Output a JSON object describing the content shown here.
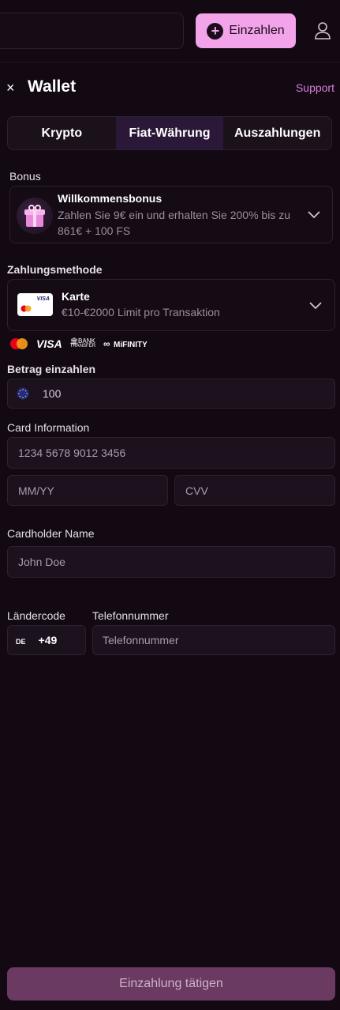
{
  "header": {
    "search_placeholder": "",
    "deposit_label": "Einzahlen",
    "plus_symbol": "+"
  },
  "wallet": {
    "close_symbol": "×",
    "title": "Wallet",
    "support_label": "Support"
  },
  "tabs": [
    {
      "label": "Krypto",
      "active": false
    },
    {
      "label": "Fiat-Währung",
      "active": true
    },
    {
      "label": "Auszahlungen",
      "active": false
    }
  ],
  "bonus": {
    "section_label": "Bonus",
    "title": "Willkommensbonus",
    "description": "Zahlen Sie 9€ ein und erhalten Sie 200% bis zu 861€ + 100 FS"
  },
  "payment_method": {
    "section_label": "Zahlungsmethode",
    "title": "Karte",
    "description": "€10-€2000 Limit pro Transaktion",
    "card_brand": "VISA",
    "logos": {
      "visa": "VISA",
      "bank_line1": "BANK",
      "bank_line2": "TRANSFER",
      "mifinity": "MiFINITY"
    }
  },
  "amount": {
    "label": "Betrag einzahlen",
    "value": "100"
  },
  "card_info": {
    "label": "Card Information",
    "number_placeholder": "1234 5678 9012 3456",
    "expiry_placeholder": "MM/YY",
    "cvv_placeholder": "CVV"
  },
  "cardholder": {
    "label": "Cardholder Name",
    "placeholder": "John Doe"
  },
  "phone": {
    "country_label": "Ländercode",
    "country_code": "DE",
    "dial_code": "+49",
    "number_label": "Telefonnummer",
    "number_placeholder": "Telefonnummer"
  },
  "submit_label": "Einzahlung tätigen",
  "colors": {
    "accent": "#f2a3ea",
    "support_link": "#d97ee0",
    "submit_bg": "#6b3a63",
    "background": "#120912"
  }
}
